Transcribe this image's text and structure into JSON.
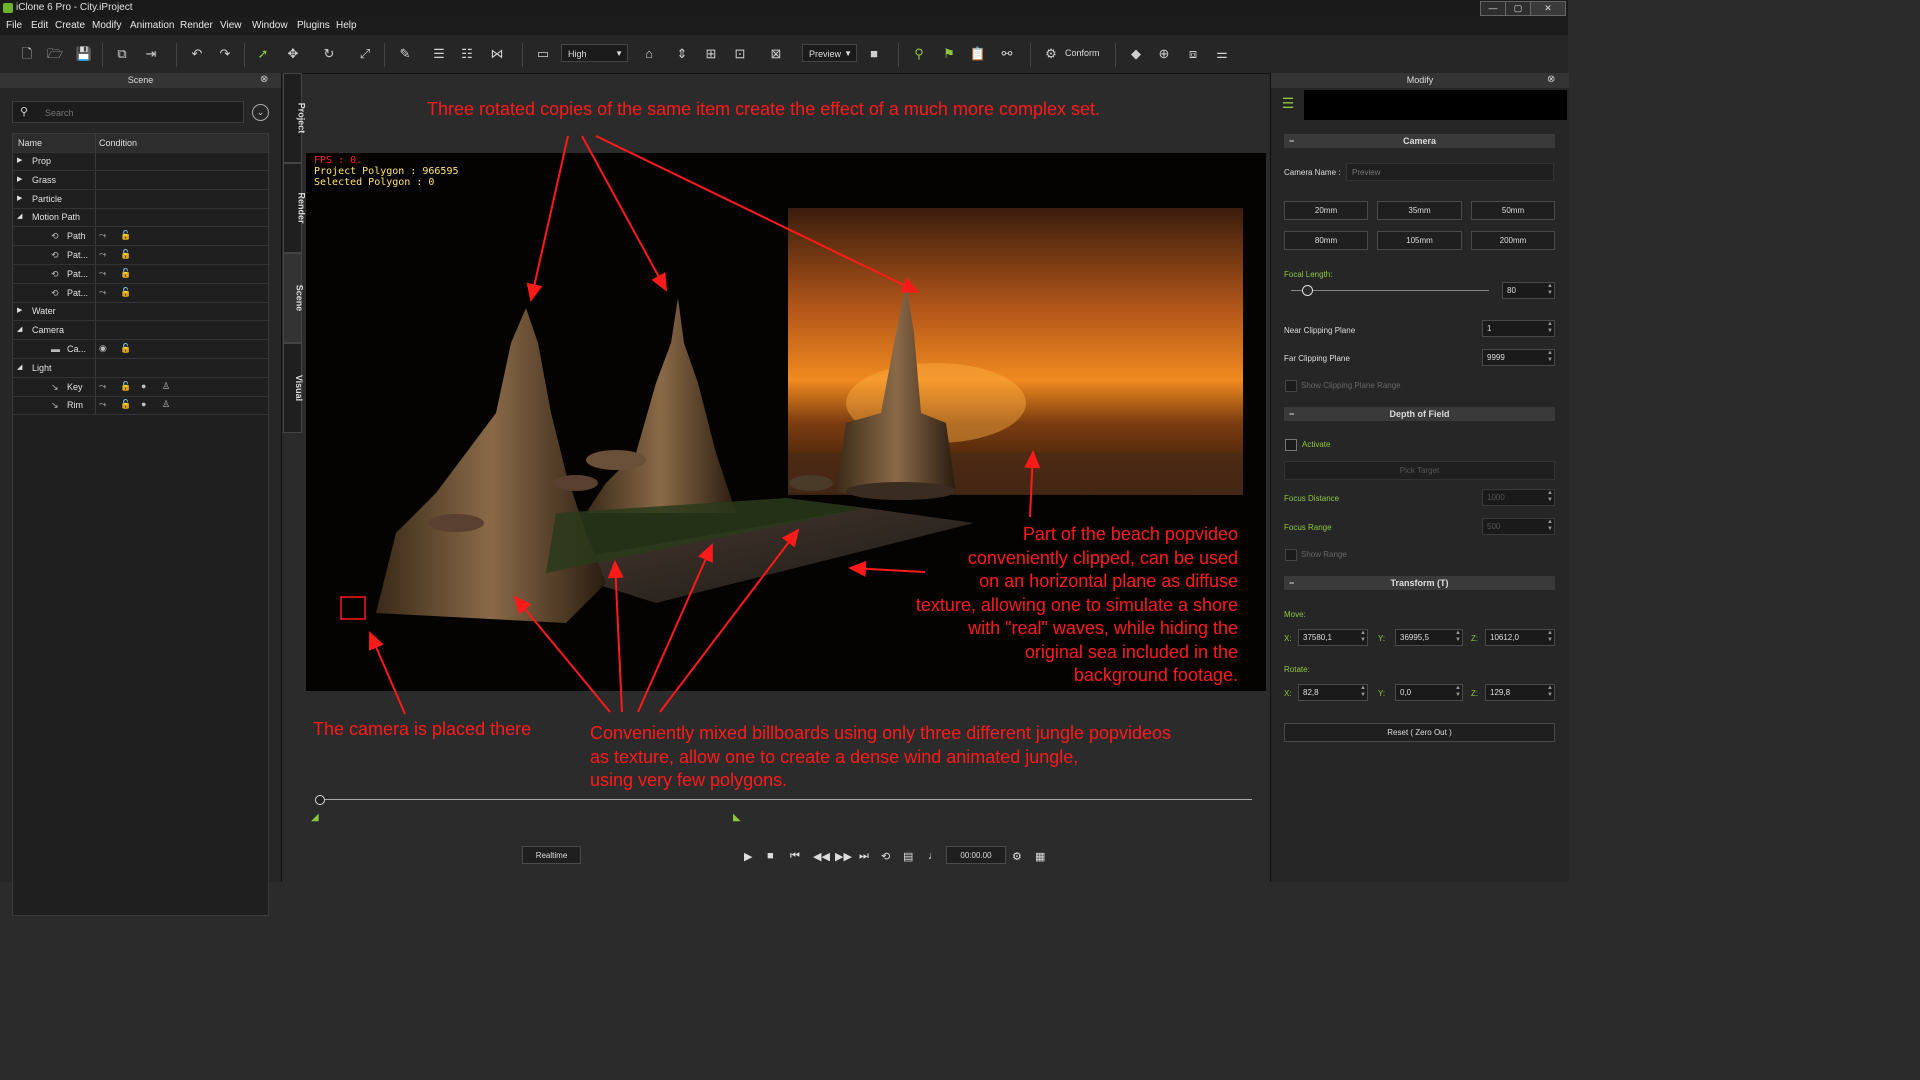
{
  "window": {
    "title": "iClone 6 Pro - City.iProject",
    "controls": [
      "—",
      "▢",
      "✕"
    ]
  },
  "menu": [
    "File",
    "Edit",
    "Create",
    "Modify",
    "Animation",
    "Render",
    "View",
    "Window",
    "Plugins",
    "Help"
  ],
  "toolbar": {
    "quality": "High",
    "camera": "Preview",
    "conform": "Conform"
  },
  "scene": {
    "title": "Scene",
    "search_placeholder": "Search",
    "columns": {
      "name": "Name",
      "condition": "Condition"
    },
    "rows": [
      {
        "label": "Prop",
        "expand": "▶"
      },
      {
        "label": "Grass",
        "expand": "▶"
      },
      {
        "label": "Particle",
        "expand": "▶"
      },
      {
        "label": "Motion Path",
        "expand": "◢"
      },
      {
        "label": "Path"
      },
      {
        "label": "Pat..."
      },
      {
        "label": "Pat..."
      },
      {
        "label": "Pat..."
      },
      {
        "label": "Water",
        "expand": "▶"
      },
      {
        "label": "Camera",
        "expand": "◢"
      },
      {
        "label": "Ca..."
      },
      {
        "label": "Light",
        "expand": "◢"
      },
      {
        "label": "Key"
      },
      {
        "label": "Rim"
      }
    ]
  },
  "side_tabs": [
    "Project",
    "Render",
    "Scene",
    "Visual"
  ],
  "viewport": {
    "stats": [
      "FPS : 0.",
      "Project Polygon : 966595",
      "Selected Polygon : 0"
    ],
    "colors": {
      "fps": "#ff2020",
      "stats": "#ffe66a"
    }
  },
  "annotations": {
    "top": "Three rotated copies of the same item create the effect of a much more complex set.",
    "beach": [
      "Part of the beach popvideo",
      "conveniently clipped, can be used",
      "on an horizontal plane as diffuse",
      "texture, allowing one to simulate a shore",
      "with \"real\" waves, while hiding the",
      "original sea included in the",
      "background footage."
    ],
    "camera": "The camera is placed there",
    "jungle": [
      "Conveniently mixed billboards using only three different jungle popvideos",
      "as texture, allow one to create a dense wind animated jungle,",
      "using very few polygons."
    ],
    "color": "#ff1a1a"
  },
  "modify": {
    "title": "Modify",
    "camera_section": "Camera",
    "camera_name_label": "Camera Name :",
    "camera_name_placeholder": "Preview",
    "lens_buttons": [
      "20mm",
      "35mm",
      "50mm",
      "80mm",
      "105mm",
      "200mm"
    ],
    "focal_length_label": "Focal Length:",
    "focal_length": "80",
    "focal_slider_fraction": 0.08,
    "near_clip_label": "Near Clipping Plane",
    "near_clip": "1",
    "far_clip_label": "Far Clipping Plane",
    "far_clip": "9999",
    "show_clip_label": "Show Clipping Plane Range",
    "dof_section": "Depth of Field",
    "activate_label": "Activate",
    "pick_target": "Pick Target",
    "focus_distance_label": "Focus Distance",
    "focus_distance": "1000",
    "focus_range_label": "Focus Range",
    "focus_range": "500",
    "show_range_label": "Show Range",
    "transform_section": "Transform  (T)",
    "move_label": "Move:",
    "move": {
      "x": "37580,1",
      "y": "36995,5",
      "z": "10612,0"
    },
    "rotate_label": "Rotate:",
    "rotate": {
      "x": "82,8",
      "y": "0,0",
      "z": "129,8"
    },
    "axis": {
      "x": "X:",
      "y": "Y:",
      "z": "Z:"
    },
    "reset": "Reset ( Zero Out )",
    "accent": "#8cc63f"
  },
  "playback": {
    "realtime": "Realtime",
    "time": "00:00.00"
  }
}
